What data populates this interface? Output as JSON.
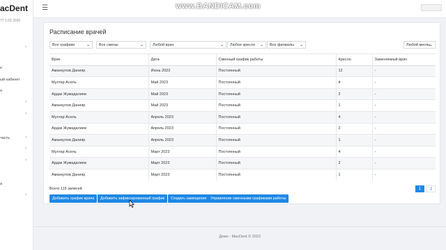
{
  "app": {
    "brand": "acDent",
    "brand_sub": "77 1.03 2020",
    "watermark": "www.BANDICAM.com"
  },
  "sidebar": {
    "items": [
      {
        "label": "",
        "chevron": "›"
      },
      {
        "label": "е",
        "chevron": ""
      },
      {
        "label": "ый кабинет",
        "chevron": ""
      },
      {
        "label": "я",
        "chevron": ""
      },
      {
        "label": "",
        "chevron": "›"
      },
      {
        "label": "",
        "chevron": "›"
      },
      {
        "label": "часть",
        "chevron": "›"
      },
      {
        "label": "",
        "chevron": "›"
      },
      {
        "label": "",
        "chevron": "›"
      },
      {
        "label": "",
        "chevron": ""
      },
      {
        "label": "а",
        "chevron": ""
      },
      {
        "label": "",
        "chevron": "›"
      }
    ]
  },
  "page": {
    "title": "Расписание врачей",
    "filters": [
      "Все графики",
      "Все смены",
      "Любой врач",
      "Любое кресло",
      "Все филиалы",
      "Любой месяц"
    ],
    "columns": [
      "Врач",
      "Дата",
      "Сменный график работы",
      "Кресло",
      "Заменяемый врач"
    ],
    "rows": [
      [
        "Аманкулов Данияр",
        "Июнь 2023",
        "Постоянный",
        "12",
        "-"
      ],
      [
        "Мухтар Асель",
        "Май 2023",
        "Постоянный",
        "4",
        "-"
      ],
      [
        "Ардак Жумадалиев",
        "Май 2023",
        "Постоянный",
        "2",
        "-"
      ],
      [
        "Аманкулов Данияр",
        "Май 2023",
        "Постоянный",
        "1",
        "-"
      ],
      [
        "Мухтар Асель",
        "Апрель 2023",
        "Постоянный",
        "4",
        "-"
      ],
      [
        "Ардак Жумадалиев",
        "Апрель 2023",
        "Постоянный",
        "2",
        "-"
      ],
      [
        "Аманкулов Данияр",
        "Апрель 2023",
        "Постоянный",
        "1",
        "-"
      ],
      [
        "Мухтар Асель",
        "Март 2023",
        "Постоянный",
        "4",
        "-"
      ],
      [
        "Ардак Жумадалиев",
        "Март 2023",
        "Постоянный",
        "2",
        "-"
      ],
      [
        "Аманкулов Данияр",
        "Март 2023",
        "Постоянный",
        "1",
        "-"
      ]
    ],
    "total": "Всего 115 записей",
    "pages": [
      "1",
      "2"
    ],
    "buttons": [
      "Добавить график врача",
      "Добавить зафиксированный график",
      "Создать замещение",
      "Управление сменными графиками работы"
    ]
  },
  "footer": {
    "text": "Демо - MacDent © 2022"
  },
  "colors": {
    "accent": "#1e88e5",
    "background": "#f0f2f5"
  }
}
